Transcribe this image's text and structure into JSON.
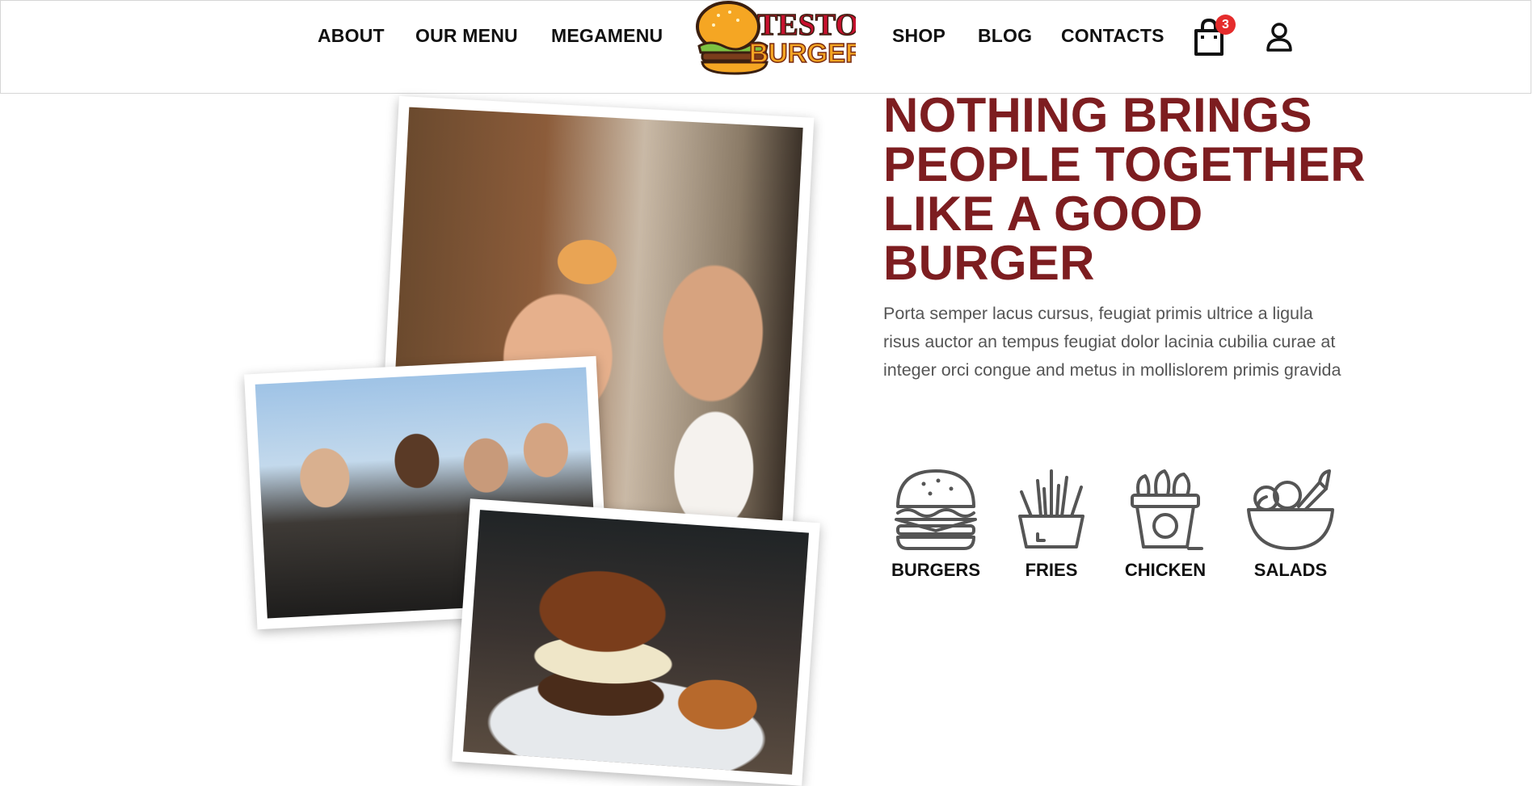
{
  "nav": {
    "left": [
      "ABOUT",
      "OUR MENU",
      "MEGAMENU"
    ],
    "right": [
      "SHOP",
      "BLOG",
      "CONTACTS"
    ]
  },
  "logo": {
    "line1": "TESTO",
    "line2": "BURGER"
  },
  "cart": {
    "icon": "shopping-bag-icon",
    "count": "3"
  },
  "user": {
    "icon": "user-icon"
  },
  "hero": {
    "title": "NOTHING BRINGS PEOPLE TOGETHER LIKE A GOOD BURGER",
    "description": "Porta semper lacus cursus, feugiat primis ultrice a ligula risus auctor an tempus feugiat dolor lacinia cubilia curae at integer orci congue and metus in mollislorem primis gravida"
  },
  "categories": [
    {
      "label": "BURGERS",
      "icon": "burger-icon"
    },
    {
      "label": "FRIES",
      "icon": "fries-icon"
    },
    {
      "label": "CHICKEN",
      "icon": "chicken-bucket-icon"
    },
    {
      "label": "SALADS",
      "icon": "salad-bowl-icon"
    }
  ],
  "colors": {
    "accent": "#7d1d20",
    "badge": "#e52c2c",
    "logo_red": "#c8102e",
    "logo_orange": "#f5a623"
  }
}
